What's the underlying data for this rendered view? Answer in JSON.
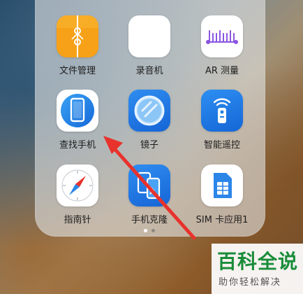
{
  "apps": [
    {
      "label": "文件管理",
      "icon": "file-folder-icon"
    },
    {
      "label": "录音机",
      "icon": "voice-waveform-icon"
    },
    {
      "label": "AR 测量",
      "icon": "ar-measure-icon"
    },
    {
      "label": "查找手机",
      "icon": "find-phone-icon"
    },
    {
      "label": "镜子",
      "icon": "mirror-icon"
    },
    {
      "label": "智能遥控",
      "icon": "remote-control-icon"
    },
    {
      "label": "指南针",
      "icon": "compass-icon"
    },
    {
      "label": "手机克隆",
      "icon": "phone-clone-icon"
    },
    {
      "label": "SIM 卡应用1",
      "icon": "sim-card-icon"
    }
  ],
  "pager": {
    "pages": 2,
    "current": 1
  },
  "watermark": {
    "title": "百科全说",
    "subtitle": "助你轻松解决"
  },
  "colors": {
    "arrow": "#e8322c",
    "accent_blue": "#1f7fe0",
    "file_orange": "#f6a81e",
    "watermark_green": "#1a8c3a"
  }
}
